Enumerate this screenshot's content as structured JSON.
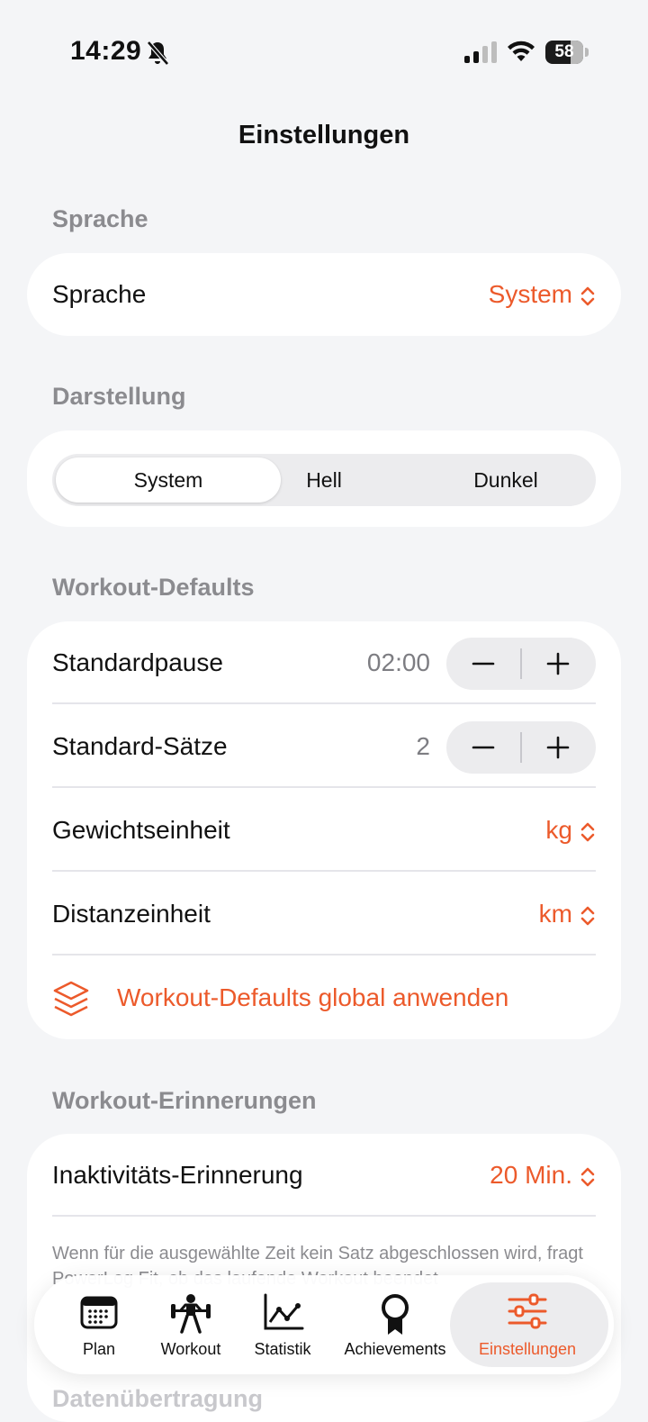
{
  "status": {
    "time": "14:29",
    "battery": "58"
  },
  "nav": {
    "title": "Einstellungen"
  },
  "sections": {
    "language": {
      "header": "Sprache",
      "row_label": "Sprache",
      "row_value": "System"
    },
    "appearance": {
      "header": "Darstellung",
      "options": [
        "System",
        "Hell",
        "Dunkel"
      ],
      "selected": "System"
    },
    "workout_defaults": {
      "header": "Workout-Defaults",
      "pause_label": "Standardpause",
      "pause_value": "02:00",
      "sets_label": "Standard-Sätze",
      "sets_value": "2",
      "weight_label": "Gewichtseinheit",
      "weight_value": "kg",
      "distance_label": "Distanzeinheit",
      "distance_value": "km",
      "apply_label": "Workout-Defaults global anwenden"
    },
    "reminders": {
      "header": "Workout-Erinnerungen",
      "row_label": "Inaktivitäts-Erinnerung",
      "row_value": "20 Min.",
      "footnote": "Wenn für die ausgewählte Zeit kein Satz abgeschlossen wird, fragt PowerLog Fit, ob das laufende Workout beendet"
    },
    "next_header": "Datenübertragung"
  },
  "tabbar": {
    "tabs": [
      {
        "label": "Plan",
        "icon": "calendar-icon"
      },
      {
        "label": "Workout",
        "icon": "weightlifter-icon"
      },
      {
        "label": "Statistik",
        "icon": "chart-icon"
      },
      {
        "label": "Achievements",
        "icon": "award-icon"
      },
      {
        "label": "Einstellungen",
        "icon": "sliders-icon"
      }
    ],
    "active": "Einstellungen"
  },
  "colors": {
    "accent": "#ec5a2b",
    "background": "#f4f5f7",
    "card": "#ffffff",
    "secondary_text": "#8b8b8f"
  }
}
